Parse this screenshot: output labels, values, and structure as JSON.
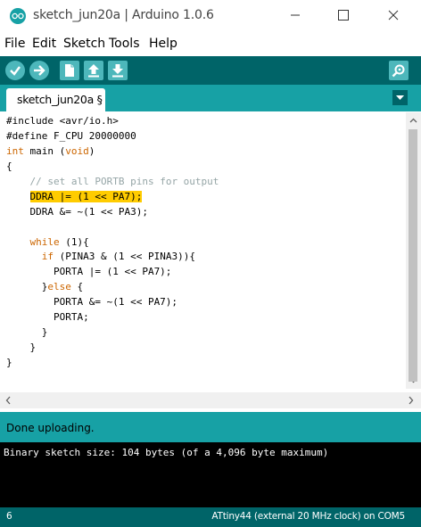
{
  "window": {
    "title": "sketch_jun20a | Arduino 1.0.6"
  },
  "menu": [
    "File",
    "Edit",
    "Sketch",
    "Tools",
    "Help"
  ],
  "toolbar": {
    "buttons": [
      "verify-icon",
      "upload-icon",
      "new-icon",
      "open-icon",
      "save-icon"
    ],
    "serial_monitor": "magnifier-icon"
  },
  "tabs": [
    {
      "label": "sketch_jun20a §",
      "active": true
    }
  ],
  "editor": {
    "lines": [
      [
        {
          "t": "#include <avr/io.h>"
        }
      ],
      [
        {
          "t": "#define F_CPU 20000000"
        }
      ],
      [
        {
          "t": "int",
          "c": "kw"
        },
        {
          "t": " main ("
        },
        {
          "t": "void",
          "c": "kw"
        },
        {
          "t": ")"
        }
      ],
      [
        {
          "t": "{"
        }
      ],
      [
        {
          "t": "    "
        },
        {
          "t": "// set all PORTB pins for output",
          "c": "cm"
        }
      ],
      [
        {
          "t": "    "
        },
        {
          "t": "DDRA |= (1 << PA7);",
          "c": "hl"
        }
      ],
      [
        {
          "t": "    DDRA &= ~(1 << PA3);"
        }
      ],
      [
        {
          "t": ""
        }
      ],
      [
        {
          "t": "    "
        },
        {
          "t": "while",
          "c": "kw"
        },
        {
          "t": " (1){"
        }
      ],
      [
        {
          "t": "      "
        },
        {
          "t": "if",
          "c": "kw"
        },
        {
          "t": " (PINA3 & (1 << PINA3)){"
        }
      ],
      [
        {
          "t": "        PORTA |= (1 << PA7);"
        }
      ],
      [
        {
          "t": "      }"
        },
        {
          "t": "else",
          "c": "kw"
        },
        {
          "t": " {"
        }
      ],
      [
        {
          "t": "        PORTA &= ~(1 << PA7);"
        }
      ],
      [
        {
          "t": "        PORTA;"
        }
      ],
      [
        {
          "t": "      }"
        }
      ],
      [
        {
          "t": "    }"
        }
      ],
      [
        {
          "t": "}"
        }
      ]
    ]
  },
  "status": {
    "message": "Done uploading."
  },
  "console": {
    "text": "Binary sketch size: 104 bytes (of a 4,096 byte maximum)"
  },
  "footer": {
    "line_number": "6",
    "board": "ATtiny44 (external 20 MHz clock) on COM5"
  },
  "colors": {
    "toolbar": "#006468",
    "tabstrip": "#17a1a5",
    "button": "#4db7bb",
    "keyword": "#cc6600",
    "comment": "#95a5a6",
    "highlight": "#ffcc00"
  }
}
